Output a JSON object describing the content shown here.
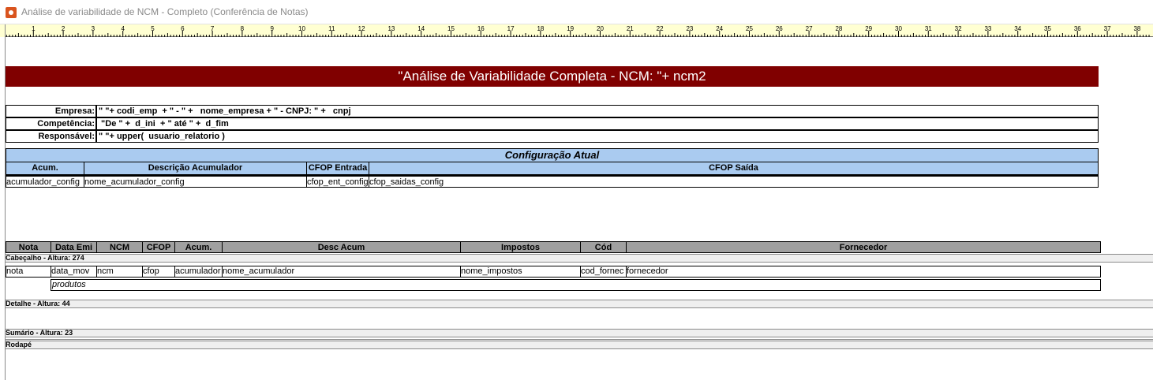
{
  "window": {
    "title": "Análise de variabilidade de NCM - Completo (Conferência de Notas)"
  },
  "ruler": {
    "numbers": [
      "1",
      "2",
      "3",
      "4",
      "5",
      "6",
      "7",
      "8",
      "9",
      "10",
      "11",
      "12",
      "13",
      "14",
      "15",
      "16",
      "17",
      "18",
      "19",
      "20",
      "21",
      "22",
      "23",
      "24",
      "25",
      "26",
      "27",
      "28",
      "29",
      "30",
      "31",
      "32",
      "33",
      "34",
      "35",
      "36",
      "37",
      "38"
    ]
  },
  "report": {
    "title": "\"Análise de Variabilidade Completa - NCM: \"+ ncm2",
    "title_bg": "#800000",
    "info": [
      {
        "label": "Empresa:",
        "value": "\" \"+ codi_emp  + \" - \" +   nome_empresa + \" - CNPJ: \" +   cnpj"
      },
      {
        "label": "Competência:",
        "value": " \"De \" +  d_ini  + \" até \" +  d_fim"
      },
      {
        "label": "Responsável:",
        "value": "\" \"+ upper(  usuario_relatorio )"
      }
    ],
    "config": {
      "header": "Configuração Atual",
      "header_bg": "#aacbf0",
      "columns": [
        "Acum.",
        "Descrição Acumulador",
        "CFOP Entrada",
        "CFOP Saída"
      ],
      "values": [
        "acumulador_config",
        "nome_acumulador_config",
        "cfop_ent_config",
        "cfop_saidas_config"
      ]
    },
    "notes": {
      "columns": [
        "Nota",
        "Data Emi",
        "NCM",
        "CFOP",
        "Acum.",
        "Desc Acum",
        "Impostos",
        "Cód",
        "Fornecedor"
      ],
      "columns_bg": "#a0a0a0",
      "fields": [
        "nota",
        "data_mov",
        "ncm",
        "cfop",
        "acumulador",
        "nome_acumulador",
        "nome_impostos",
        "cod_fornec",
        "fornecedor"
      ],
      "subreport": "produtos"
    },
    "bands": {
      "header": "Cabeçalho - Altura: 274",
      "detail": "Detalhe - Altura: 44",
      "summary": "Sumário - Altura: 23",
      "footer": "Rodapé"
    }
  }
}
